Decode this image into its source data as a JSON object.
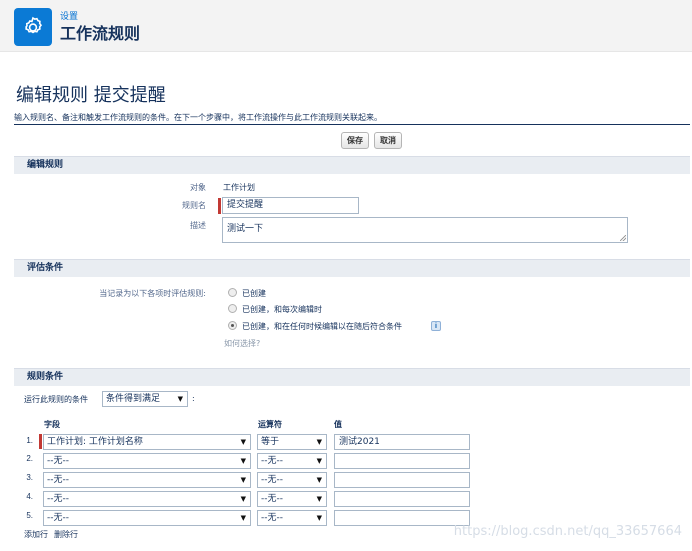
{
  "header": {
    "breadcrumb": "设置",
    "title": "工作流规则",
    "icon": "gear-icon"
  },
  "page": {
    "heading": "编辑规则 提交提醒",
    "instructions": "输入规则名、备注和触发工作流规则的条件。在下一个步骤中，将工作流操作与此工作流规则关联起来。"
  },
  "toolbar": {
    "save_label": "保存",
    "cancel_label": "取消"
  },
  "edit_rule": {
    "section_title": "编辑规则",
    "object_label": "对象",
    "object_value": "工作计划",
    "rule_name_label": "规则名",
    "rule_name_value": "提交提醒",
    "description_label": "描述",
    "description_value": "测试一下"
  },
  "evaluation": {
    "section_title": "评估条件",
    "prompt": "当记录为以下各项时评估规则:",
    "options": [
      {
        "label": "已创建",
        "selected": false
      },
      {
        "label": "已创建，和每次编辑时",
        "selected": false
      },
      {
        "label": "已创建，和在任何时候编辑以在随后符合条件",
        "selected": true
      }
    ],
    "help_link": "如何选择?",
    "info_icon": "info-icon"
  },
  "rule_criteria": {
    "section_title": "规则条件",
    "run_label": "运行此规则的条件",
    "run_value": "条件得到满足",
    "run_suffix": ":",
    "columns": {
      "field": "字段",
      "operator": "运算符",
      "value": "值"
    },
    "rows": [
      {
        "num": "1.",
        "field": "工作计划: 工作计划名称",
        "operator": "等于",
        "value": "测试2021"
      },
      {
        "num": "2.",
        "field": "--无--",
        "operator": "--无--",
        "value": ""
      },
      {
        "num": "3.",
        "field": "--无--",
        "operator": "--无--",
        "value": ""
      },
      {
        "num": "4.",
        "field": "--无--",
        "operator": "--无--",
        "value": ""
      },
      {
        "num": "5.",
        "field": "--无--",
        "operator": "--无--",
        "value": ""
      }
    ],
    "add_row": "添加行",
    "delete_row": "删除行"
  },
  "watermark": "https://blog.csdn.net/qq_33657664"
}
